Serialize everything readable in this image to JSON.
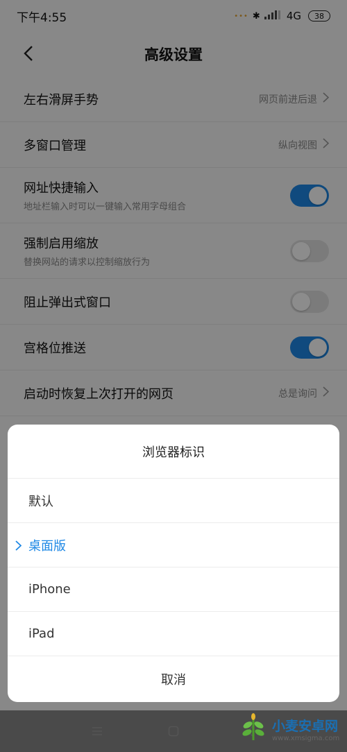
{
  "status_bar": {
    "time": "下午4:55",
    "network": "4G",
    "battery": "38"
  },
  "header": {
    "title": "高级设置"
  },
  "settings": [
    {
      "label": "左右滑屏手势",
      "value": "网页前进后退"
    },
    {
      "label": "多窗口管理",
      "value": "纵向视图"
    },
    {
      "label": "网址快捷输入",
      "subtitle": "地址栏输入时可以一键输入常用字母组合",
      "toggle": true
    },
    {
      "label": "强制启用缩放",
      "subtitle": "替换网站的请求以控制缩放行为",
      "toggle": false
    },
    {
      "label": "阻止弹出式窗口",
      "toggle": false
    },
    {
      "label": "宫格位推送",
      "toggle": true
    },
    {
      "label": "启动时恢复上次打开的网页",
      "value": "总是询问"
    }
  ],
  "sheet": {
    "title": "浏览器标识",
    "options": [
      "默认",
      "桌面版",
      "iPhone",
      "iPad"
    ],
    "selected": "桌面版",
    "cancel": "取消"
  },
  "watermark": {
    "text": "小麦安卓网",
    "url": "www.xmsigma.com"
  },
  "colors": {
    "accent": "#1e88e5",
    "toggle_off": "#e0e0e0"
  }
}
